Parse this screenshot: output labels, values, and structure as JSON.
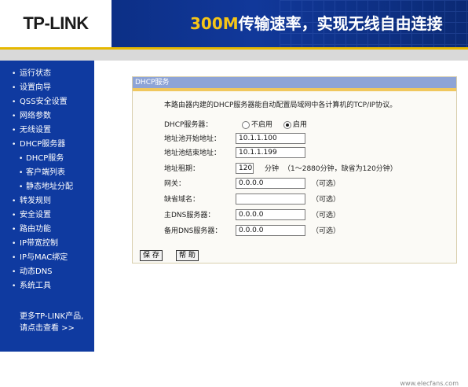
{
  "header": {
    "logo": "TP-LINK",
    "slogan_speed": "300M",
    "slogan_text": "传输速率，实现无线自由连接"
  },
  "sidebar": {
    "items": [
      {
        "label": "运行状态",
        "level": 1
      },
      {
        "label": "设置向导",
        "level": 1
      },
      {
        "label": "QSS安全设置",
        "level": 1
      },
      {
        "label": "网络参数",
        "level": 1
      },
      {
        "label": "无线设置",
        "level": 1
      },
      {
        "label": "DHCP服务器",
        "level": 1
      },
      {
        "label": "DHCP服务",
        "level": 2
      },
      {
        "label": "客户端列表",
        "level": 2
      },
      {
        "label": "静态地址分配",
        "level": 2
      },
      {
        "label": "转发规则",
        "level": 1
      },
      {
        "label": "安全设置",
        "level": 1
      },
      {
        "label": "路由功能",
        "level": 1
      },
      {
        "label": "IP带宽控制",
        "level": 1
      },
      {
        "label": "IP与MAC绑定",
        "level": 1
      },
      {
        "label": "动态DNS",
        "level": 1
      },
      {
        "label": "系统工具",
        "level": 1
      }
    ],
    "more_line1": "更多TP-LINK产品,",
    "more_line2": "请点击查看 >>"
  },
  "panel": {
    "title": "DHCP服务",
    "intro": "本路由器内建的DHCP服务器能自动配置局域网中各计算机的TCP/IP协议。",
    "dhcp_server_label": "DHCP服务器：",
    "option_disable": "不启用",
    "option_enable": "启用",
    "selected": "启用",
    "start_label": "地址池开始地址：",
    "start_value": "10.1.1.100",
    "end_label": "地址池结束地址：",
    "end_value": "10.1.1.199",
    "lease_label": "地址租期：",
    "lease_value": "120",
    "lease_unit": "分钟",
    "lease_hint": "（1～2880分钟，缺省为120分钟）",
    "gateway_label": "网关：",
    "gateway_value": "0.0.0.0",
    "domain_label": "缺省域名：",
    "domain_value": "",
    "dns1_label": "主DNS服务器：",
    "dns1_value": "0.0.0.0",
    "dns2_label": "备用DNS服务器：",
    "dns2_value": "0.0.0.0",
    "optional": "（可选）",
    "save_label": "保 存",
    "help_label": "帮 助"
  },
  "footer": {
    "copyright": "www.elecfans.com"
  }
}
